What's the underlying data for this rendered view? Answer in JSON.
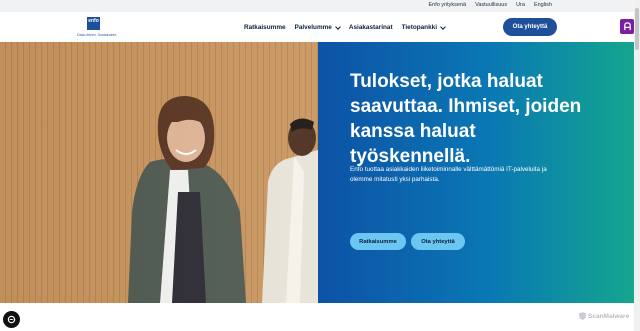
{
  "topbar": {
    "links": [
      "Enfo yrityksenä",
      "Vastuullisuus",
      "Ura",
      "English"
    ]
  },
  "logo": {
    "mark": "enfo",
    "tagline": "Data-driven. Sustainable."
  },
  "nav": {
    "items": [
      {
        "label": "Ratkaisumme",
        "dropdown": false
      },
      {
        "label": "Palvelumme",
        "dropdown": true
      },
      {
        "label": "Asiakastarinat",
        "dropdown": false
      },
      {
        "label": "Tietopankki",
        "dropdown": true
      }
    ],
    "cta_label": "Ota yhteyttä"
  },
  "hero": {
    "headline": "Tulokset, jotka haluat saavuttaa. Ihmiset, joiden kanssa haluat työskennellä.",
    "subtext": "Enfo tuottaa asiakkaiden liiketoiminnalle välttämättömiä IT-palveluita ja olemme mitatusti yksi parhaista.",
    "buttons": [
      "Ratkaisumme",
      "Ota yhteyttä"
    ]
  },
  "watermark": "ScanMalware",
  "colors": {
    "brand_blue": "#1d4f9a",
    "gradient_start": "#0d52a6",
    "gradient_end": "#14a68e",
    "pill": "#6bc6f2",
    "widget": "#7a1fa2"
  },
  "icons": [
    "chevron-down-icon",
    "chat-widget-icon",
    "cookie-settings-icon",
    "shield-icon"
  ]
}
